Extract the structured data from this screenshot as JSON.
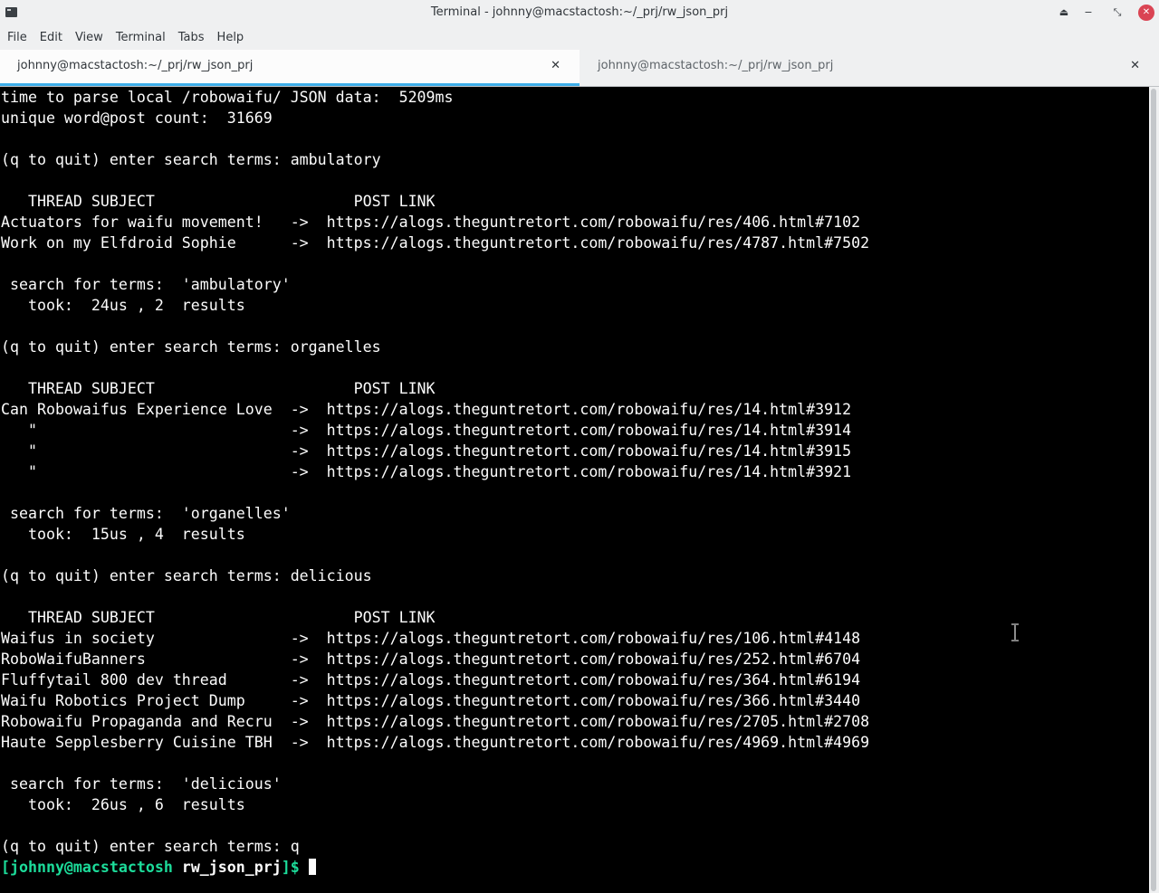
{
  "window": {
    "title": "Terminal - johnny@macstactosh:~/_prj/rw_json_prj",
    "buttons": [
      "⏏",
      "−",
      "⤡",
      "✕"
    ]
  },
  "menubar": {
    "items": [
      "File",
      "Edit",
      "View",
      "Terminal",
      "Tabs",
      "Help"
    ]
  },
  "tabs": [
    {
      "label": "johnny@macstactosh:~/_prj/rw_json_prj",
      "active": true
    },
    {
      "label": "johnny@macstactosh:~/_prj/rw_json_prj",
      "active": false
    }
  ],
  "terminal": {
    "lines": [
      "time to parse local /robowaifu/ JSON data:  5209ms",
      "unique word@post count:  31669",
      "",
      "(q to quit) enter search terms: ambulatory",
      "",
      "   THREAD SUBJECT                      POST LINK",
      "Actuators for waifu movement!   ->  https://alogs.theguntretort.com/robowaifu/res/406.html#7102",
      "Work on my Elfdroid Sophie      ->  https://alogs.theguntretort.com/robowaifu/res/4787.html#7502",
      "",
      " search for terms:  'ambulatory'",
      "   took:  24us , 2  results",
      "",
      "(q to quit) enter search terms: organelles",
      "",
      "   THREAD SUBJECT                      POST LINK",
      "Can Robowaifus Experience Love  ->  https://alogs.theguntretort.com/robowaifu/res/14.html#3912",
      "   \"                            ->  https://alogs.theguntretort.com/robowaifu/res/14.html#3914",
      "   \"                            ->  https://alogs.theguntretort.com/robowaifu/res/14.html#3915",
      "   \"                            ->  https://alogs.theguntretort.com/robowaifu/res/14.html#3921",
      "",
      " search for terms:  'organelles'",
      "   took:  15us , 4  results",
      "",
      "(q to quit) enter search terms: delicious",
      "",
      "   THREAD SUBJECT                      POST LINK",
      "Waifus in society               ->  https://alogs.theguntretort.com/robowaifu/res/106.html#4148",
      "RoboWaifuBanners                ->  https://alogs.theguntretort.com/robowaifu/res/252.html#6704",
      "Fluffytail 800 dev thread       ->  https://alogs.theguntretort.com/robowaifu/res/364.html#6194",
      "Waifu Robotics Project Dump     ->  https://alogs.theguntretort.com/robowaifu/res/366.html#3440",
      "Robowaifu Propaganda and Recru  ->  https://alogs.theguntretort.com/robowaifu/res/2705.html#2708",
      "Haute Sepplesberry Cuisine TBH  ->  https://alogs.theguntretort.com/robowaifu/res/4969.html#4969",
      "",
      " search for terms:  'delicious'",
      "   took:  26us , 6  results",
      "",
      "(q to quit) enter search terms: q"
    ],
    "prompt": {
      "user_host": "[johnny@macstactosh",
      "dir": "rw_json_prj",
      "suffix": "]$"
    },
    "colors": {
      "background": "#000000",
      "foreground": "#fcfcfc",
      "prompt_green": "#1cdc9a",
      "tab_accent": "#3daee9"
    }
  }
}
